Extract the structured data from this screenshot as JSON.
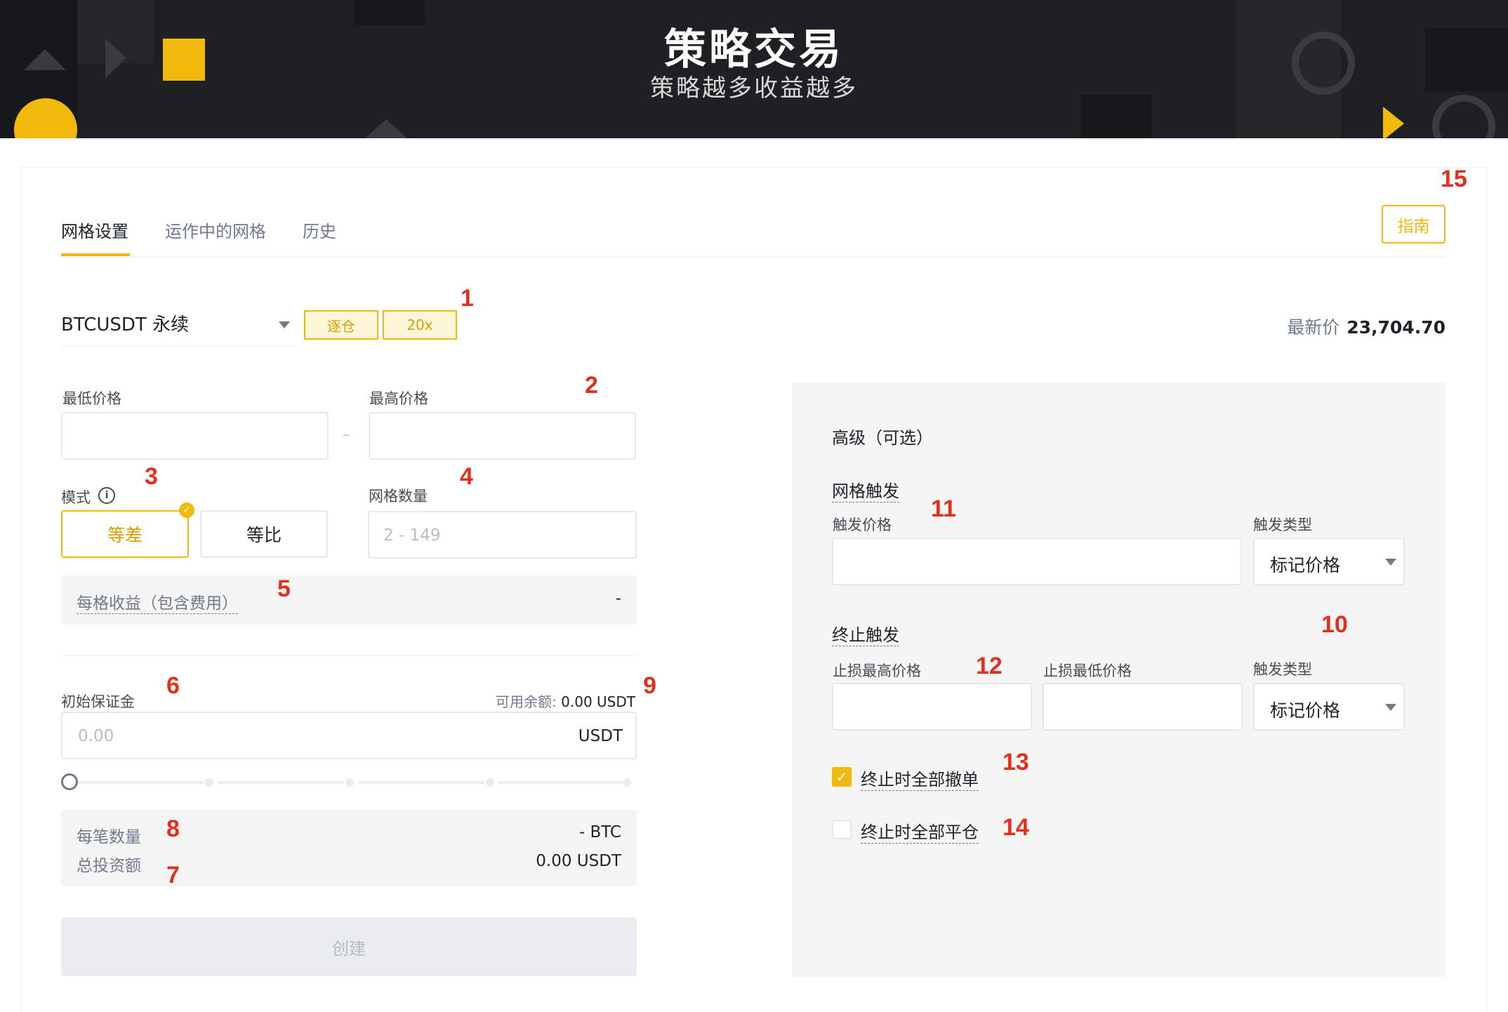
{
  "banner": {
    "title": "策略交易",
    "subtitle": "策略越多收益越多"
  },
  "tabs": [
    {
      "label": "网格设置",
      "active": true
    },
    {
      "label": "运作中的网格",
      "active": false
    },
    {
      "label": "历史",
      "active": false
    }
  ],
  "guide_button": "指南",
  "symbol": {
    "name": "BTCUSDT 永续",
    "margin_mode": "逐仓",
    "leverage": "20x",
    "latest_price_label": "最新价",
    "latest_price": "23,704.70"
  },
  "price_range": {
    "min_label": "最低价格",
    "max_label": "最高价格",
    "separator": "–"
  },
  "mode": {
    "label": "模式",
    "info_icon": "i",
    "options": [
      "等差",
      "等比"
    ],
    "selected": "等差"
  },
  "grid_count": {
    "label": "网格数量",
    "placeholder": "2 - 149"
  },
  "profit_per_grid": {
    "label": "每格收益（包含费用）",
    "value": "-"
  },
  "initial_margin": {
    "label": "初始保证金",
    "available_label": "可用余额:",
    "available_value": "0.00 USDT",
    "placeholder": "0.00",
    "unit": "USDT",
    "slider_level": 0
  },
  "summary": {
    "qty_label": "每笔数量",
    "qty_value": "- BTC",
    "total_label": "总投资额",
    "total_value": "0.00 USDT"
  },
  "create_button": "创建",
  "advanced": {
    "title": "高级（可选）",
    "grid_trigger": {
      "heading": "网格触发",
      "trigger_price_label": "触发价格",
      "trigger_type_label": "触发类型",
      "trigger_type_value": "标记价格"
    },
    "stop_trigger": {
      "heading": "终止触发",
      "stop_high_label": "止损最高价格",
      "stop_low_label": "止损最低价格",
      "trigger_type_label": "触发类型",
      "trigger_type_value": "标记价格"
    },
    "cancel_all_on_stop": {
      "label": "终止时全部撤单",
      "checked": true
    },
    "close_all_on_stop": {
      "label": "终止时全部平仓",
      "checked": false
    }
  },
  "callouts": [
    "1",
    "2",
    "3",
    "4",
    "5",
    "6",
    "7",
    "8",
    "9",
    "10",
    "11",
    "12",
    "13",
    "14",
    "15"
  ],
  "colors": {
    "accent": "#f0b90b",
    "banner_bg": "#1f2024",
    "annotation": "#e0301e"
  }
}
